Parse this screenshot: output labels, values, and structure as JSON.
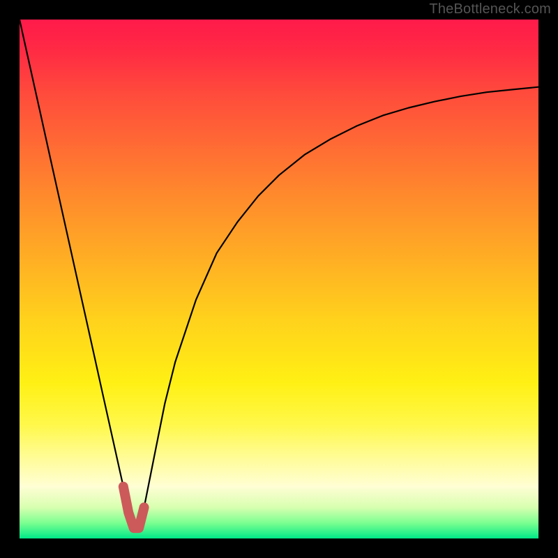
{
  "watermark": {
    "text": "TheBottleneck.com"
  },
  "colors": {
    "background": "#000000",
    "accent_stroke": "#cc5a5a",
    "curve_stroke": "#000000",
    "gradient_top": "#ff1a4a",
    "gradient_bottom": "#00e888"
  },
  "chart_data": {
    "type": "line",
    "title": "",
    "xlabel": "",
    "ylabel": "",
    "xlim": [
      0,
      100
    ],
    "ylim": [
      0,
      100
    ],
    "grid": false,
    "legend": false,
    "annotations": [
      "TheBottleneck.com"
    ],
    "series": [
      {
        "name": "bottleneck-curve",
        "x": [
          0,
          2,
          4,
          6,
          8,
          10,
          12,
          14,
          16,
          18,
          20,
          21,
          22,
          23,
          24,
          26,
          28,
          30,
          34,
          38,
          42,
          46,
          50,
          55,
          60,
          65,
          70,
          75,
          80,
          85,
          90,
          95,
          100
        ],
        "values": [
          100,
          91,
          82,
          73,
          64,
          55,
          46,
          37,
          28,
          19,
          10,
          5,
          2,
          2,
          6,
          16,
          26,
          34,
          46,
          55,
          61,
          66,
          70,
          74,
          77,
          79.5,
          81.5,
          83,
          84.2,
          85.2,
          86,
          86.5,
          87
        ]
      }
    ],
    "accent_region": {
      "x": [
        20,
        21,
        22,
        23,
        24
      ],
      "values": [
        10,
        5,
        2,
        2,
        6
      ],
      "color": "#cc5a5a"
    },
    "background_gradient": {
      "direction": "vertical",
      "meaning": "value-scale (red=high, green=low)",
      "stops": [
        {
          "pos": 0.0,
          "color": "#ff1a4a"
        },
        {
          "pos": 0.5,
          "color": "#ffd21c"
        },
        {
          "pos": 0.85,
          "color": "#fffed4"
        },
        {
          "pos": 1.0,
          "color": "#00e888"
        }
      ]
    }
  }
}
